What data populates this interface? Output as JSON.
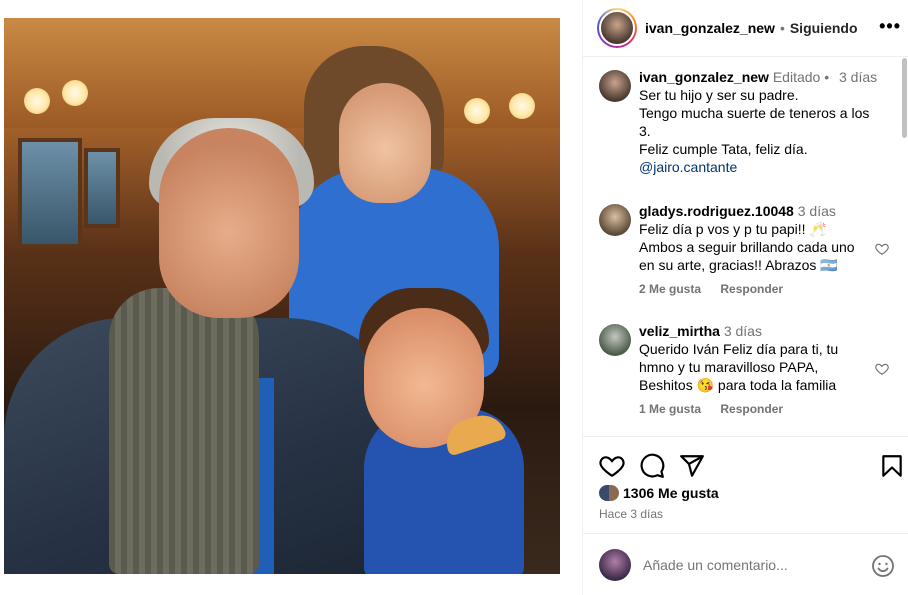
{
  "header": {
    "username": "ivan_gonzalez_new",
    "separator": "•",
    "follow_status": "Siguiendo",
    "more": "•••"
  },
  "caption": {
    "username": "ivan_gonzalez_new",
    "edited": "Editado",
    "separator": "•",
    "time": "3 días",
    "lines": [
      "Ser tu hijo y ser su padre.",
      "Tengo mucha suerte de teneros a los",
      "3.",
      "Feliz cumple Tata, feliz día."
    ],
    "mention": "@jairo.cantante"
  },
  "comments": [
    {
      "username": "gladys.rodriguez.10048",
      "time": "3 días",
      "lines": [
        "Feliz día p vos y p tu papi!! 🥂",
        "Ambos a seguir brillando cada uno",
        "en su arte, gracias!! Abrazos 🇦🇷"
      ],
      "likes": "2 Me gusta",
      "reply": "Responder"
    },
    {
      "username": "veliz_mirtha",
      "time": "3 días",
      "lines": [
        "Querido Iván Feliz día para ti, tu",
        "hmno y tu maravilloso PAPA,",
        "Beshitos 😘 para toda la familia"
      ],
      "likes": "1 Me gusta",
      "reply": "Responder"
    }
  ],
  "post": {
    "likes": "1306 Me gusta",
    "date": "Hace 3 días"
  },
  "add_comment": {
    "placeholder": "Añade un comentario..."
  },
  "icons": {
    "like": "heart-icon",
    "comment": "comment-icon",
    "share": "send-icon",
    "save": "bookmark-icon",
    "emoji": "emoji-icon",
    "more": "more-icon"
  },
  "colors": {
    "mention": "#00376b",
    "meta": "#737373",
    "border": "#efefef"
  }
}
